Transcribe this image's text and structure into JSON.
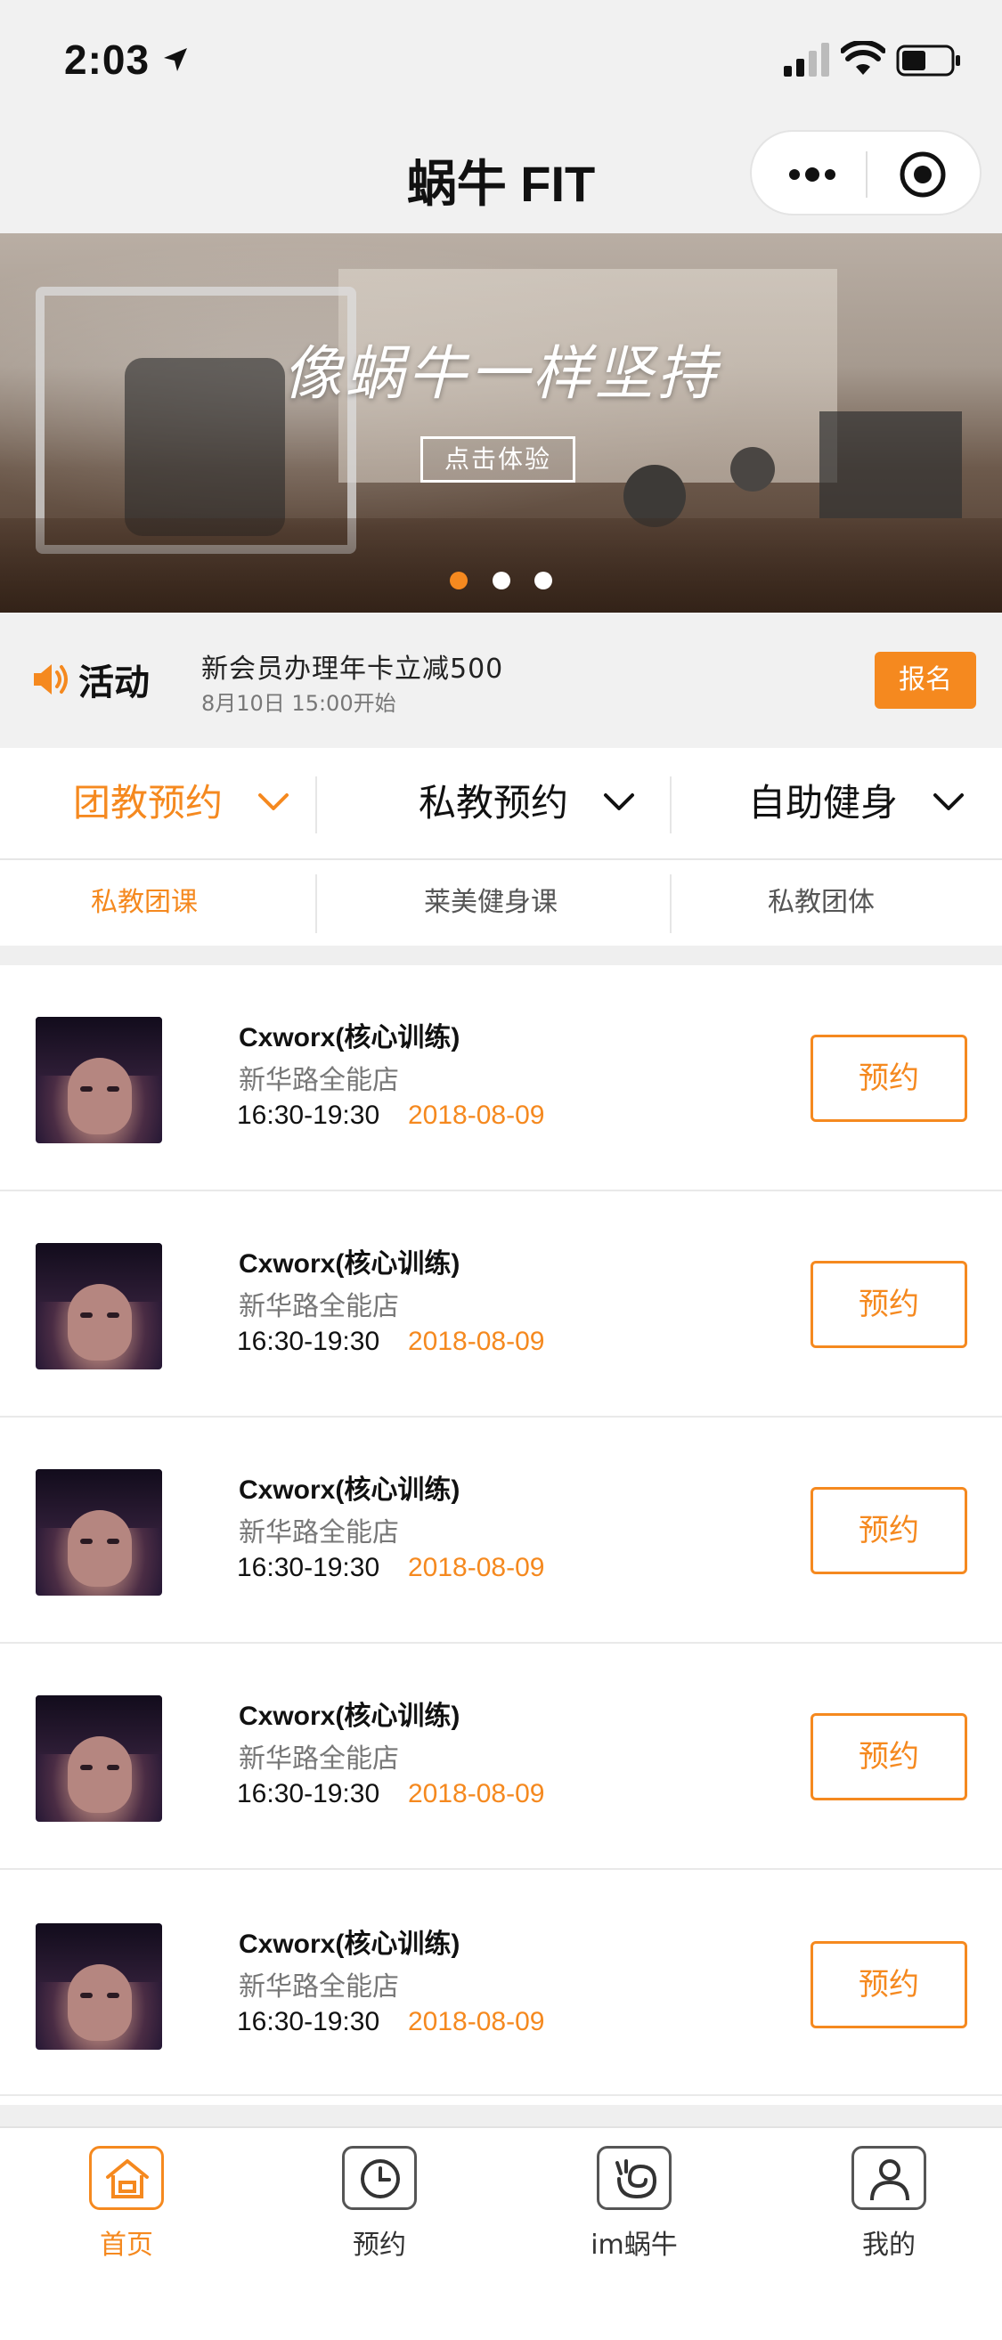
{
  "status_bar": {
    "time": "2:03"
  },
  "nav": {
    "title": "蜗牛 FIT"
  },
  "banner": {
    "title": "像蜗牛一样坚持",
    "button": "点击体验",
    "slides": 3,
    "active_slide": 1
  },
  "activity": {
    "label": "活动",
    "title": "新会员办理年卡立减500",
    "time": "8月10日 15:00开始",
    "signup": "报名"
  },
  "tabs": [
    {
      "label": "团教预约",
      "active": true
    },
    {
      "label": "私教预约",
      "active": false
    },
    {
      "label": "自助健身",
      "active": false
    }
  ],
  "subtabs": [
    {
      "label": "私教团课",
      "active": true
    },
    {
      "label": "莱美健身课",
      "active": false
    },
    {
      "label": "私教团体",
      "active": false
    }
  ],
  "courses": [
    {
      "name": "Cxworx(核心训练)",
      "store": "新华路全能店",
      "time": "16:30-19:30",
      "date": "2018-08-09",
      "action": "预约"
    },
    {
      "name": "Cxworx(核心训练)",
      "store": "新华路全能店",
      "time": "16:30-19:30",
      "date": "2018-08-09",
      "action": "预约"
    },
    {
      "name": "Cxworx(核心训练)",
      "store": "新华路全能店",
      "time": "16:30-19:30",
      "date": "2018-08-09",
      "action": "预约"
    },
    {
      "name": "Cxworx(核心训练)",
      "store": "新华路全能店",
      "time": "16:30-19:30",
      "date": "2018-08-09",
      "action": "预约"
    },
    {
      "name": "Cxworx(核心训练)",
      "store": "新华路全能店",
      "time": "16:30-19:30",
      "date": "2018-08-09",
      "action": "预约"
    }
  ],
  "tabbar": [
    {
      "label": "首页",
      "icon": "home-icon",
      "active": true
    },
    {
      "label": "预约",
      "icon": "clock-icon",
      "active": false
    },
    {
      "label": "im蜗牛",
      "icon": "snail-icon",
      "active": false
    },
    {
      "label": "我的",
      "icon": "user-icon",
      "active": false
    }
  ],
  "colors": {
    "accent": "#f5891f",
    "text": "#111111",
    "muted": "#777777",
    "background": "#f1f1f1"
  }
}
